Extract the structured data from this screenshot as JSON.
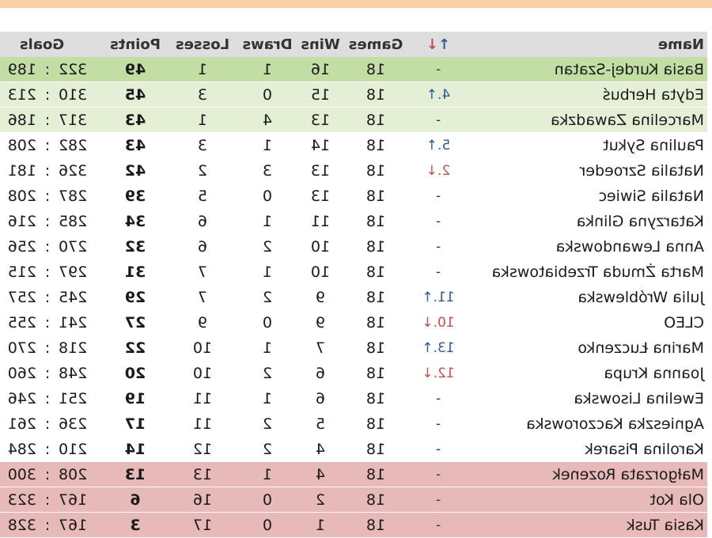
{
  "title": "",
  "header": {
    "name": "Name",
    "trend_up": "↑",
    "trend_down": "↓",
    "games": "Games",
    "wins": "Wins",
    "draws": "Draws",
    "losses": "Losses",
    "points": "Points",
    "goals": "Goals"
  },
  "colors": {
    "header_bg": "#dedede",
    "leader_row": "#c3dea4",
    "promotion_rows": "#e4efd6",
    "relegation_rows": "#e8b9b9",
    "up_arrow": "#2f5a93",
    "down_arrow": "#c0504d"
  },
  "rows": [
    {
      "name": "Basia Kurdej-Szatan",
      "trend": "-",
      "dir": "flat",
      "games": "18",
      "wins": "16",
      "draws": "1",
      "losses": "1",
      "points": "49",
      "gf": "322",
      "ga": "189",
      "zone": "promo1"
    },
    {
      "name": "Edyta Herbuś",
      "trend": "4.↑",
      "dir": "up",
      "games": "18",
      "wins": "15",
      "draws": "0",
      "losses": "3",
      "points": "45",
      "gf": "310",
      "ga": "213",
      "zone": "promo2"
    },
    {
      "name": "Marcelina Zawadzka",
      "trend": "-",
      "dir": "flat",
      "games": "18",
      "wins": "13",
      "draws": "4",
      "losses": "1",
      "points": "43",
      "gf": "317",
      "ga": "186",
      "zone": "promo2"
    },
    {
      "name": "Paulina Sykut",
      "trend": "5.↑",
      "dir": "up",
      "games": "18",
      "wins": "14",
      "draws": "1",
      "losses": "3",
      "points": "43",
      "gf": "282",
      "ga": "208",
      "zone": ""
    },
    {
      "name": "Natalia Szroeder",
      "trend": "2.↓",
      "dir": "down",
      "games": "18",
      "wins": "13",
      "draws": "3",
      "losses": "2",
      "points": "42",
      "gf": "326",
      "ga": "181",
      "zone": ""
    },
    {
      "name": "Natalia Siwiec",
      "trend": "-",
      "dir": "flat",
      "games": "18",
      "wins": "13",
      "draws": "0",
      "losses": "5",
      "points": "39",
      "gf": "287",
      "ga": "208",
      "zone": ""
    },
    {
      "name": "Katarzyna Glinka",
      "trend": "-",
      "dir": "flat",
      "games": "18",
      "wins": "11",
      "draws": "1",
      "losses": "6",
      "points": "34",
      "gf": "285",
      "ga": "216",
      "zone": ""
    },
    {
      "name": "Anna Lewandowska",
      "trend": "-",
      "dir": "flat",
      "games": "18",
      "wins": "10",
      "draws": "2",
      "losses": "6",
      "points": "32",
      "gf": "270",
      "ga": "256",
      "zone": ""
    },
    {
      "name": "Marta Żmuda Trzebiatowska",
      "trend": "-",
      "dir": "flat",
      "games": "18",
      "wins": "10",
      "draws": "1",
      "losses": "7",
      "points": "31",
      "gf": "297",
      "ga": "215",
      "zone": ""
    },
    {
      "name": "Julia Wróblewska",
      "trend": "11.↑",
      "dir": "up",
      "games": "18",
      "wins": "9",
      "draws": "2",
      "losses": "7",
      "points": "29",
      "gf": "245",
      "ga": "257",
      "zone": ""
    },
    {
      "name": "CLEO",
      "trend": "10.↓",
      "dir": "down",
      "games": "18",
      "wins": "9",
      "draws": "0",
      "losses": "9",
      "points": "27",
      "gf": "241",
      "ga": "255",
      "zone": ""
    },
    {
      "name": "Marina Łuczenko",
      "trend": "13.↑",
      "dir": "up",
      "games": "18",
      "wins": "7",
      "draws": "1",
      "losses": "10",
      "points": "22",
      "gf": "218",
      "ga": "270",
      "zone": ""
    },
    {
      "name": "Joanna Krupa",
      "trend": "12.↓",
      "dir": "down",
      "games": "18",
      "wins": "6",
      "draws": "2",
      "losses": "10",
      "points": "20",
      "gf": "248",
      "ga": "260",
      "zone": ""
    },
    {
      "name": "Ewelina Lisowska",
      "trend": "-",
      "dir": "flat",
      "games": "18",
      "wins": "6",
      "draws": "1",
      "losses": "11",
      "points": "19",
      "gf": "251",
      "ga": "246",
      "zone": ""
    },
    {
      "name": "Agnieszka Kaczorowska",
      "trend": "-",
      "dir": "flat",
      "games": "18",
      "wins": "5",
      "draws": "2",
      "losses": "11",
      "points": "17",
      "gf": "236",
      "ga": "261",
      "zone": ""
    },
    {
      "name": "Karolina Pisarek",
      "trend": "-",
      "dir": "flat",
      "games": "18",
      "wins": "4",
      "draws": "2",
      "losses": "12",
      "points": "14",
      "gf": "210",
      "ga": "284",
      "zone": ""
    },
    {
      "name": "Małgorzata Rozenek",
      "trend": "-",
      "dir": "flat",
      "games": "18",
      "wins": "4",
      "draws": "1",
      "losses": "13",
      "points": "13",
      "gf": "208",
      "ga": "300",
      "zone": "releg"
    },
    {
      "name": "Ola Kot",
      "trend": "-",
      "dir": "flat",
      "games": "18",
      "wins": "2",
      "draws": "0",
      "losses": "16",
      "points": "6",
      "gf": "167",
      "ga": "323",
      "zone": "releg"
    },
    {
      "name": "Kasia Tusk",
      "trend": "-",
      "dir": "flat",
      "games": "18",
      "wins": "1",
      "draws": "0",
      "losses": "17",
      "points": "3",
      "gf": "167",
      "ga": "328",
      "zone": "releg"
    }
  ]
}
